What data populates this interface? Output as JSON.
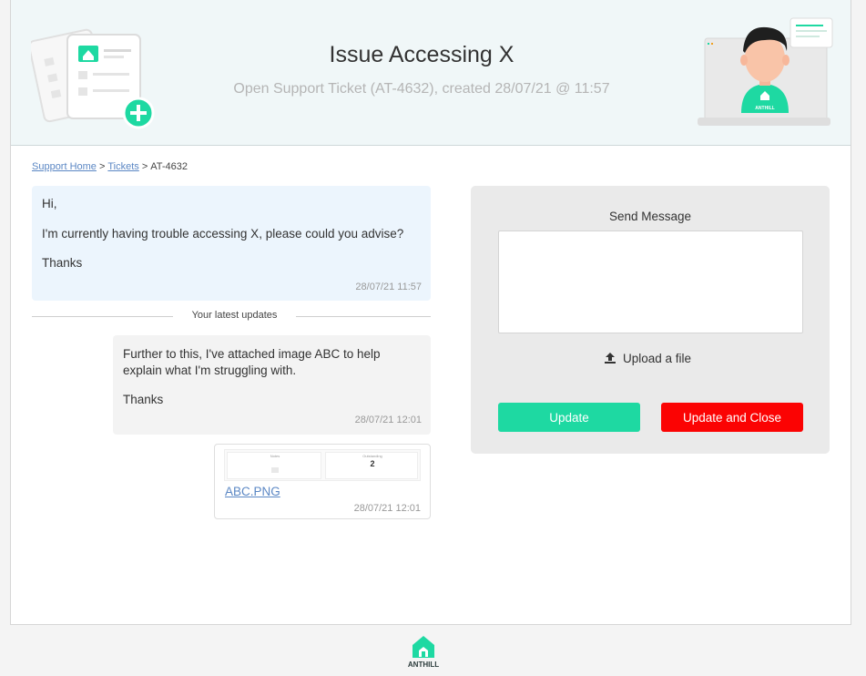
{
  "header": {
    "title": "Issue Accessing X",
    "subtitle": "Open Support Ticket (AT-4632), created 28/07/21 @ 11:57",
    "mascot_badge": "ANTHILL"
  },
  "breadcrumb": {
    "items": [
      {
        "label": "Support Home",
        "link": true
      },
      {
        "label": "Tickets",
        "link": true
      },
      {
        "label": "AT-4632",
        "link": false
      }
    ],
    "separator": ">"
  },
  "thread": {
    "original": {
      "lines": [
        "Hi,",
        "I'm currently having trouble accessing X, please could you advise?",
        "Thanks"
      ],
      "timestamp": "28/07/21 11:57"
    },
    "divider_label": "Your latest updates",
    "update": {
      "lines": [
        "Further to this, I've attached image ABC to help explain what I'm struggling with.",
        "Thanks"
      ],
      "timestamp": "28/07/21 12:01"
    },
    "attachment": {
      "filename": "ABC.PNG",
      "timestamp": "28/07/21 12:01",
      "thumb_col1": "Notes",
      "thumb_col2": "Outstanding",
      "thumb_value": "2"
    }
  },
  "send_panel": {
    "title": "Send Message",
    "message_value": "",
    "upload_label": "Upload a file",
    "update_label": "Update",
    "update_close_label": "Update and Close"
  },
  "footer": {
    "brand": "ANTHILL"
  },
  "colors": {
    "accent_green": "#1ed9a2",
    "danger_red": "#fb0303",
    "link_blue": "#5b87c4",
    "header_bg": "#f0f7f8"
  }
}
